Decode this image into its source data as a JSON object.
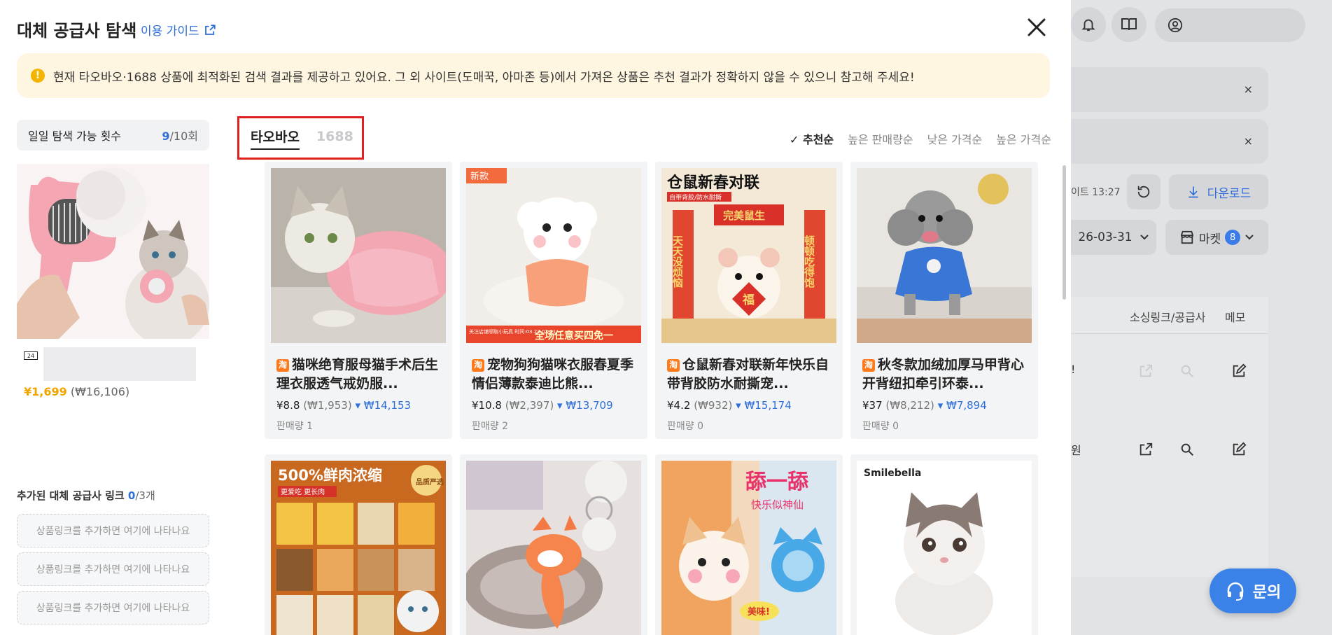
{
  "modal": {
    "title": "대체 공급사 탐색",
    "guide_link": "이용 가이드",
    "notice": "현재 타오바오·1688 상품에 최적화된 검색 결과를 제공하고 있어요. 그 외 사이트(도매꾹, 아마존 등)에서 가져온 상품은 추천 결과가 정확하지 않을 수 있으니 참고해 주세요!",
    "warn_glyph": "!",
    "close_icon": "close-icon"
  },
  "left": {
    "daily_label": "일일 탐색 가능 횟수",
    "daily_used": "9",
    "daily_total": "/10회",
    "source_price_cny": "¥1,699",
    "source_price_krw": "(₩16,106)",
    "shop_glyph": "24",
    "added_label": "추가된 대체 공급사 링크",
    "added_count": "0",
    "added_total": "/3개",
    "slots": [
      "상품링크를 추가하면 여기에 나타나요",
      "상품링크를 추가하면 여기에 나타나요",
      "상품링크를 추가하면 여기에 나타나요"
    ]
  },
  "tabs": [
    {
      "label": "타오바오",
      "active": true
    },
    {
      "label": "1688",
      "active": false
    }
  ],
  "sort": {
    "check": "✓",
    "items": [
      "추천순",
      "높은 판매량순",
      "낮은 가격순",
      "높은 가격순"
    ]
  },
  "products": [
    {
      "title": "猫咪绝育服母猫手术后生理衣服透气戒奶服...",
      "price_cny": "¥8.8",
      "price_krw": "(₩1,953)",
      "price_diff": "₩14,153",
      "sales": "판매량 1"
    },
    {
      "title": "宠物狗狗猫咪衣服春夏季情侣薄款泰迪比熊...",
      "price_cny": "¥10.8",
      "price_krw": "(₩2,397)",
      "price_diff": "₩13,709",
      "sales": "판매량 2",
      "img_top": "新款",
      "img_bottom": "全场任意买四免一",
      "img_bottom_small": "关注店铺领取小玩具 时间:03.23-03.31"
    },
    {
      "title": "仓鼠新春对联新年快乐自带背胶防水耐撕宠...",
      "price_cny": "¥4.2",
      "price_krw": "(₩932)",
      "price_diff": "₩15,174",
      "sales": "판매량 0",
      "img_top": "仓鼠新春对联",
      "img_sub": "自带背胶/防水耐撕",
      "img_left": "天天没烦恼",
      "img_right": "顿顿吃得饱",
      "img_banner": "完美鼠生",
      "img_fu": "福"
    },
    {
      "title": "秋冬款加绒加厚马甲背心开背纽扣牵引环泰...",
      "price_cny": "¥37",
      "price_krw": "(₩8,212)",
      "price_diff": "₩7,894",
      "sales": "판매량 0"
    },
    {
      "img_top": "500%鲜肉浓缩",
      "img_sub": "更爱吃 更长肉",
      "img_badge": "品质严选"
    },
    {},
    {
      "img_top": "舔一舔",
      "img_sub": "快乐似神仙",
      "img_badge": "美味!"
    },
    {
      "img_top": "Smilebella"
    }
  ],
  "taobao_mark": "淘",
  "down_mark": "▾",
  "background": {
    "update_text": "이트 13:27",
    "download": "다운로드",
    "date": "26-03-31",
    "market": "마켓",
    "market_count": "8",
    "col_sourcing": "소싱링크/공급사",
    "col_memo": "메모",
    "row1_text": "!",
    "row2_text": "원",
    "inquiry": "문의",
    "field_close": "×"
  },
  "colors": {
    "accent": "#2f6fd8",
    "highlight_border": "#e02020",
    "notice_bg": "#fff6e1",
    "price_orange": "#f0a500",
    "taobao": "#ff7a1a"
  }
}
